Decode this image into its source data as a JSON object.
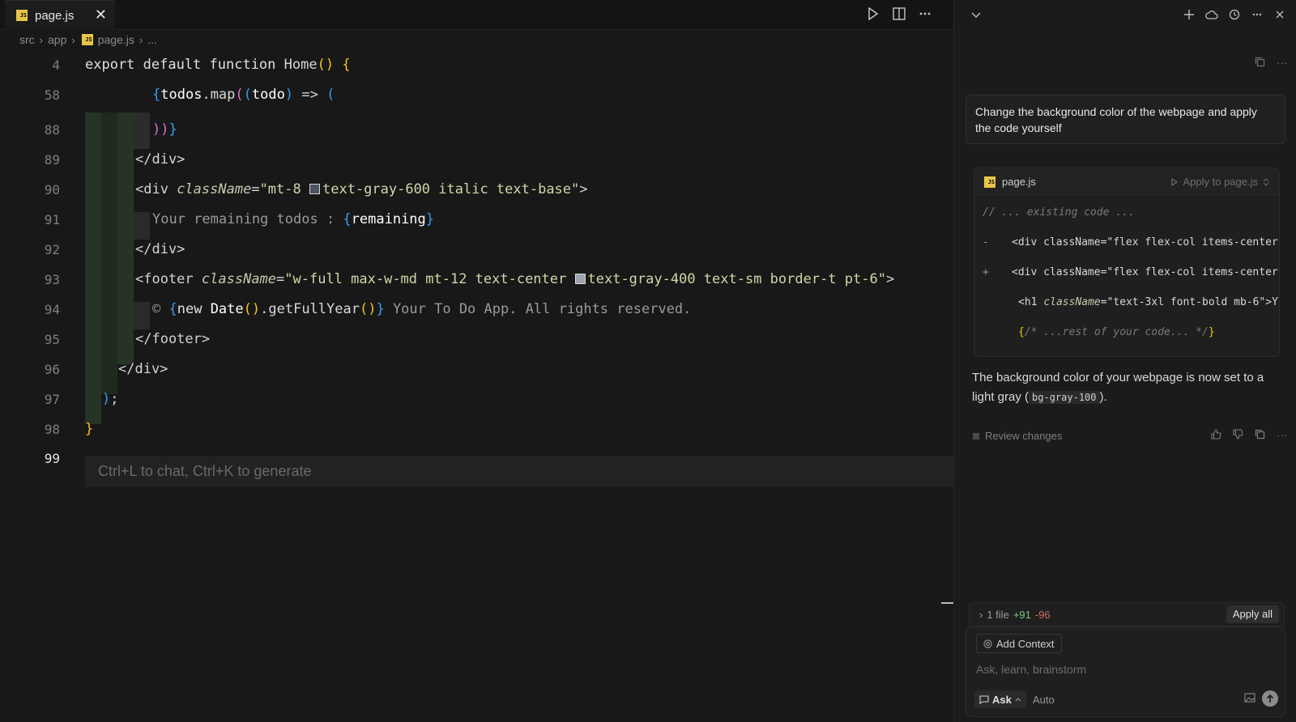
{
  "editor": {
    "tab": {
      "label": "page.js",
      "badge": "JS"
    },
    "breadcrumb": [
      "src",
      "app",
      "page.js",
      "..."
    ],
    "lines": [
      {
        "num": "4"
      },
      {
        "num": "58"
      },
      {
        "num": "88"
      },
      {
        "num": "89"
      },
      {
        "num": "90"
      },
      {
        "num": "91"
      },
      {
        "num": "92"
      },
      {
        "num": "93"
      },
      {
        "num": "94"
      },
      {
        "num": "95"
      },
      {
        "num": "96"
      },
      {
        "num": "97"
      },
      {
        "num": "98"
      },
      {
        "num": "99"
      }
    ],
    "code": {
      "l4": {
        "kw": "export default function ",
        "name": "Home",
        "paren": "()",
        "brace": " {"
      },
      "l58": {
        "open": "{",
        "obj": "todos",
        "dot": ".",
        "method": "map",
        "p1": "(",
        "p2": "(",
        "arg": "todo",
        "p2c": ")",
        "arrow": " => ",
        "p3": "("
      },
      "l88": {
        "close": "))",
        "brace": "}"
      },
      "l89": {
        "tag": "</div>"
      },
      "l90": {
        "open": "<div ",
        "attr": "className",
        "eq": "=",
        "str1": "\"mt-8 ",
        "str2": "text-gray-600 italic text-base\"",
        "end": ">"
      },
      "l91": {
        "text": "Your remaining todos : ",
        "open": "{",
        "var": "remaining",
        "close": "}"
      },
      "l92": {
        "tag": "</div>"
      },
      "l93": {
        "open": "<footer ",
        "attr": "className",
        "eq": "=",
        "str1": "\"w-full max-w-md mt-12 text-center ",
        "str2": "text-gray-400 text-sm border-t pt-6\"",
        "end": ">"
      },
      "l94": {
        "copy": "© ",
        "open": "{",
        "kw": "new ",
        "cls": "Date",
        "p": "()",
        "dot": ".",
        "method": "getFullYear",
        "p2": "()",
        "close": "}",
        "text": " Your To Do App. All rights reserved."
      },
      "l95": {
        "tag": "</footer>"
      },
      "l96": {
        "tag": "</div>"
      },
      "l97": {
        "paren": ")",
        "semi": ";"
      },
      "l98": {
        "brace": "}"
      }
    },
    "placeholder": "Ctrl+L to chat, Ctrl+K to generate"
  },
  "chat": {
    "user_message": "Change the background color of the webpage and apply the code yourself",
    "code_block": {
      "file": "page.js",
      "apply_label": "Apply to page.js",
      "lines": [
        {
          "marker": "",
          "code": "// ... existing code ..."
        },
        {
          "marker": "-",
          "code": "<div className=\"flex flex-col items-center"
        },
        {
          "marker": "+",
          "code": "<div className=\"flex flex-col items-center"
        },
        {
          "marker": "",
          "h1_open": "<h1 ",
          "h1_attr": "className",
          "h1_rest": "=\"text-3xl font-bold mb-6\">Y"
        },
        {
          "marker": "",
          "brace_open": "{",
          "comment": "/* ...rest of your code... */",
          "brace_close": "}"
        }
      ]
    },
    "assistant_text_1": "The background color of your webpage is now set to a light gray (",
    "assistant_code": "bg-gray-100",
    "assistant_text_2": ").",
    "review_label": "Review changes",
    "changes": {
      "files": "1 file",
      "added": "+91",
      "removed": "-96",
      "apply_all": "Apply all"
    },
    "composer": {
      "add_context": "Add Context",
      "placeholder": "Ask, learn, brainstorm",
      "mode": "Ask",
      "model": "Auto"
    }
  },
  "colors": {
    "accent_yellow": "#f5c518",
    "magenta": "#d670d6",
    "blue": "#3a9cf0",
    "added_green": "#7ec77e",
    "removed_red": "#d46a6a"
  }
}
